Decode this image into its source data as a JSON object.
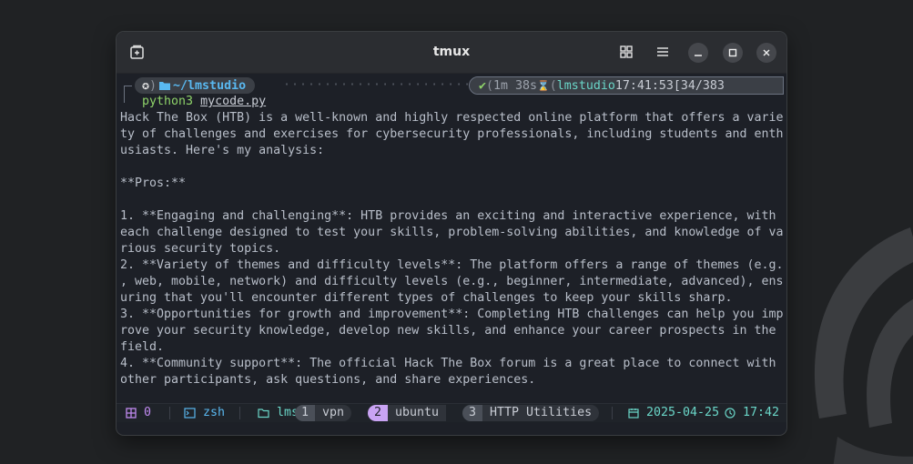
{
  "window": {
    "title": "tmux"
  },
  "icons": {
    "new_tab": "new-tab-icon",
    "grid": "grid-icon",
    "menu": "menu-icon",
    "minimize": "minimize-icon",
    "maximize": "maximize-icon",
    "close": "close-icon"
  },
  "prompt": {
    "os_glyph": "✪",
    "path": "~/lmstudio",
    "status_ok": "✔",
    "duration": "1m 38s",
    "hourglass": "⌛",
    "env": "lmstudio",
    "time": "17:41:53",
    "counter": "[34/383"
  },
  "command": {
    "program": "python3",
    "arg": "mycode.py"
  },
  "output_lines": [
    "Hack The Box (HTB) is a well-known and highly respected online platform that offers a varie",
    "ty of challenges and exercises for cybersecurity professionals, including students and enth",
    "usiasts. Here's my analysis:",
    "",
    "**Pros:**",
    "",
    "1. **Engaging and challenging**: HTB provides an exciting and interactive experience, with",
    "each challenge designed to test your skills, problem-solving abilities, and knowledge of va",
    "rious security topics.",
    "2. **Variety of themes and difficulty levels**: The platform offers a range of themes (e.g.",
    ", web, mobile, network) and difficulty levels (e.g., beginner, intermediate, advanced), ens",
    "uring that you'll encounter different types of challenges to keep your skills sharp.",
    "3. **Opportunities for growth and improvement**: Completing HTB challenges can help you imp",
    "rove your security knowledge, develop new skills, and enhance your career prospects in the",
    "field.",
    "4. **Community support**: The official Hack The Box forum is a great place to connect with",
    "other participants, ask questions, and share experiences."
  ],
  "statusbar": {
    "session_count": "0",
    "shell": "zsh",
    "dir": "lms",
    "windows": [
      {
        "num": "1",
        "name": "vpn"
      },
      {
        "num": "2",
        "name": "ubuntu"
      },
      {
        "num": "3",
        "name": "HTTP Utilities"
      }
    ],
    "date": "2025-04-25",
    "clock": "17:42"
  },
  "colors": {
    "accent_blue": "#59b8f0",
    "accent_green": "#8fd46a",
    "accent_purple": "#c08af0",
    "accent_teal": "#6ad6c8",
    "active_window": "#c9a3f3"
  }
}
